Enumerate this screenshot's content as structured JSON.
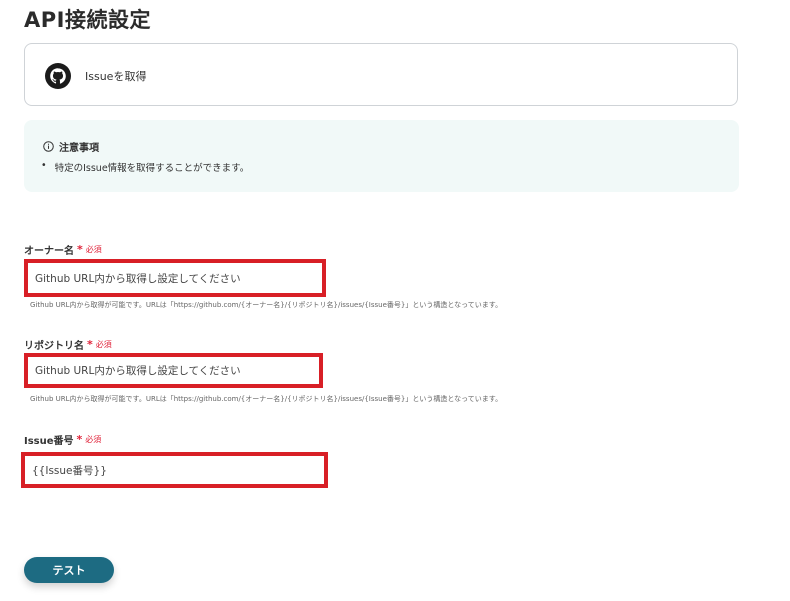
{
  "page": {
    "title": "API接続設定"
  },
  "action": {
    "label": "Issueを取得",
    "icon": "github-icon"
  },
  "notice": {
    "title": "注意事項",
    "items": [
      "特定のIssue情報を取得することができます。"
    ],
    "icon": "info-icon"
  },
  "required_text": "必須",
  "required_mark": "*",
  "fields": [
    {
      "label": "オーナー名",
      "value": "Github URL内から取得し設定してください",
      "hint": "Github URL内から取得が可能です。URLは「https://github.com/{オーナー名}/{リポジトリ名}/issues/{Issue番号}」という構造となっています。"
    },
    {
      "label": "リポジトリ名",
      "value": "Github URL内から取得し設定してください",
      "hint": "Github URL内から取得が可能です。URLは「https://github.com/{オーナー名}/{リポジトリ名}/issues/{Issue番号}」という構造となっています。"
    },
    {
      "label": "Issue番号",
      "value": "{{Issue番号}}"
    }
  ],
  "test_button": {
    "label": "テスト"
  },
  "colors": {
    "accent": "#1d6b82",
    "required": "#e0233a",
    "highlight_border": "#d81f26",
    "notice_bg": "#f1f9f8"
  }
}
